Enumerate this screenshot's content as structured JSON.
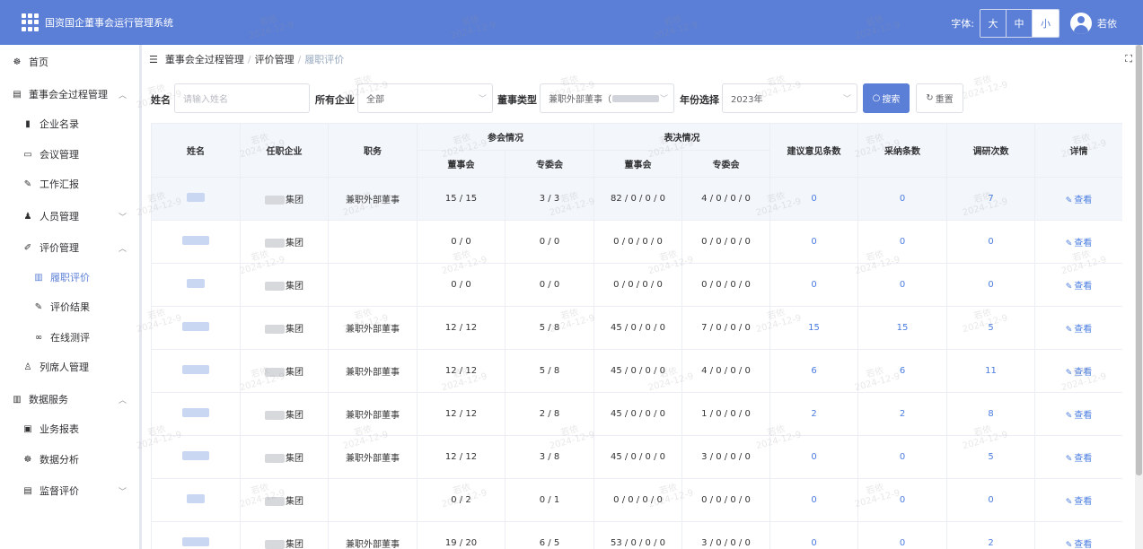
{
  "header": {
    "title": "国资国企董事会运行管理系统",
    "font_label": "字体:",
    "font_sizes": [
      "大",
      "中",
      "小"
    ],
    "username": "若依"
  },
  "sidebar": {
    "items": [
      {
        "label": "首页",
        "icon": "dashboard-icon"
      },
      {
        "label": "董事会全过程管理",
        "icon": "document-icon",
        "arrow": "︿"
      },
      {
        "label": "企业名录",
        "icon": "book-icon"
      },
      {
        "label": "会议管理",
        "icon": "meeting-icon"
      },
      {
        "label": "工作汇报",
        "icon": "report-icon"
      },
      {
        "label": "人员管理",
        "icon": "people-icon",
        "arrow": "﹀"
      },
      {
        "label": "评价管理",
        "icon": "edit-icon",
        "arrow": "︿"
      },
      {
        "label": "履职评价",
        "icon": "bar-chart-icon"
      },
      {
        "label": "评价结果",
        "icon": "edit-icon"
      },
      {
        "label": "在线测评",
        "icon": "link-icon"
      },
      {
        "label": "列席人管理",
        "icon": "user-icon"
      },
      {
        "label": "数据服务",
        "icon": "bar-chart-icon",
        "arrow": "︿"
      },
      {
        "label": "业务报表",
        "icon": "monitor-icon"
      },
      {
        "label": "数据分析",
        "icon": "dashboard-icon"
      },
      {
        "label": "监督评价",
        "icon": "document-icon",
        "arrow": "﹀"
      }
    ]
  },
  "breadcrumb": [
    "董事会全过程管理",
    "评价管理",
    "履职评价"
  ],
  "filters": {
    "name_label": "姓名",
    "name_placeholder": "请输入姓名",
    "company_label": "所有企业",
    "company_value": "全部",
    "type_label": "董事类型",
    "type_value": "兼职外部董事（",
    "year_label": "年份选择",
    "year_value": "2023年",
    "search_label": "搜索",
    "reset_label": "重置"
  },
  "table": {
    "headers": {
      "name": "姓名",
      "company": "任职企业",
      "position": "职务",
      "attend": "参会情况",
      "vote": "表决情况",
      "board": "董事会",
      "committee": "专委会",
      "suggestions": "建议意见条数",
      "adopted": "采纳条数",
      "research": "调研次数",
      "detail": "详情"
    },
    "rows": [
      {
        "company": "集团",
        "position": "兼职外部董事",
        "attend_board": "15 / 15",
        "attend_comm": "3 / 3",
        "vote_board": "82 / 0 / 0 / 0",
        "vote_comm": "4 / 0 / 0 / 0",
        "suggestions": "0",
        "adopted": "0",
        "research": "7",
        "detail": "查看"
      },
      {
        "company": "集团",
        "position": "",
        "attend_board": "0 / 0",
        "attend_comm": "0 / 0",
        "vote_board": "0 / 0 / 0 / 0",
        "vote_comm": "0 / 0 / 0 / 0",
        "suggestions": "0",
        "adopted": "0",
        "research": "0",
        "detail": "查看"
      },
      {
        "company": "集团",
        "position": "",
        "attend_board": "0 / 0",
        "attend_comm": "0 / 0",
        "vote_board": "0 / 0 / 0 / 0",
        "vote_comm": "0 / 0 / 0 / 0",
        "suggestions": "0",
        "adopted": "0",
        "research": "0",
        "detail": "查看"
      },
      {
        "company": "集团",
        "position": "兼职外部董事",
        "attend_board": "12 / 12",
        "attend_comm": "5 / 8",
        "vote_board": "45 / 0 / 0 / 0",
        "vote_comm": "7 / 0 / 0 / 0",
        "suggestions": "15",
        "adopted": "15",
        "research": "5",
        "detail": "查看"
      },
      {
        "company": "集团",
        "position": "兼职外部董事",
        "attend_board": "12 / 12",
        "attend_comm": "5 / 8",
        "vote_board": "45 / 0 / 0 / 0",
        "vote_comm": "4 / 0 / 0 / 0",
        "suggestions": "6",
        "adopted": "6",
        "research": "11",
        "detail": "查看"
      },
      {
        "company": "集团",
        "position": "兼职外部董事",
        "attend_board": "12 / 12",
        "attend_comm": "2 / 8",
        "vote_board": "45 / 0 / 0 / 0",
        "vote_comm": "1 / 0 / 0 / 0",
        "suggestions": "2",
        "adopted": "2",
        "research": "8",
        "detail": "查看"
      },
      {
        "company": "集团",
        "position": "兼职外部董事",
        "attend_board": "12 / 12",
        "attend_comm": "3 / 8",
        "vote_board": "45 / 0 / 0 / 0",
        "vote_comm": "3 / 0 / 0 / 0",
        "suggestions": "0",
        "adopted": "0",
        "research": "5",
        "detail": "查看"
      },
      {
        "company": "集团",
        "position": "",
        "attend_board": "0 / 2",
        "attend_comm": "0 / 1",
        "vote_board": "0 / 0 / 0 / 0",
        "vote_comm": "0 / 0 / 0 / 0",
        "suggestions": "0",
        "adopted": "0",
        "research": "0",
        "detail": "查看"
      },
      {
        "company": "集团",
        "position": "兼职外部董事",
        "attend_board": "19 / 20",
        "attend_comm": "6 / 5",
        "vote_board": "53 / 0 / 0 / 0",
        "vote_comm": "3 / 0 / 0 / 0",
        "suggestions": "0",
        "adopted": "0",
        "research": "2",
        "detail": "查看"
      }
    ]
  },
  "watermark": {
    "name": "若依",
    "date": "2024-12-9"
  }
}
